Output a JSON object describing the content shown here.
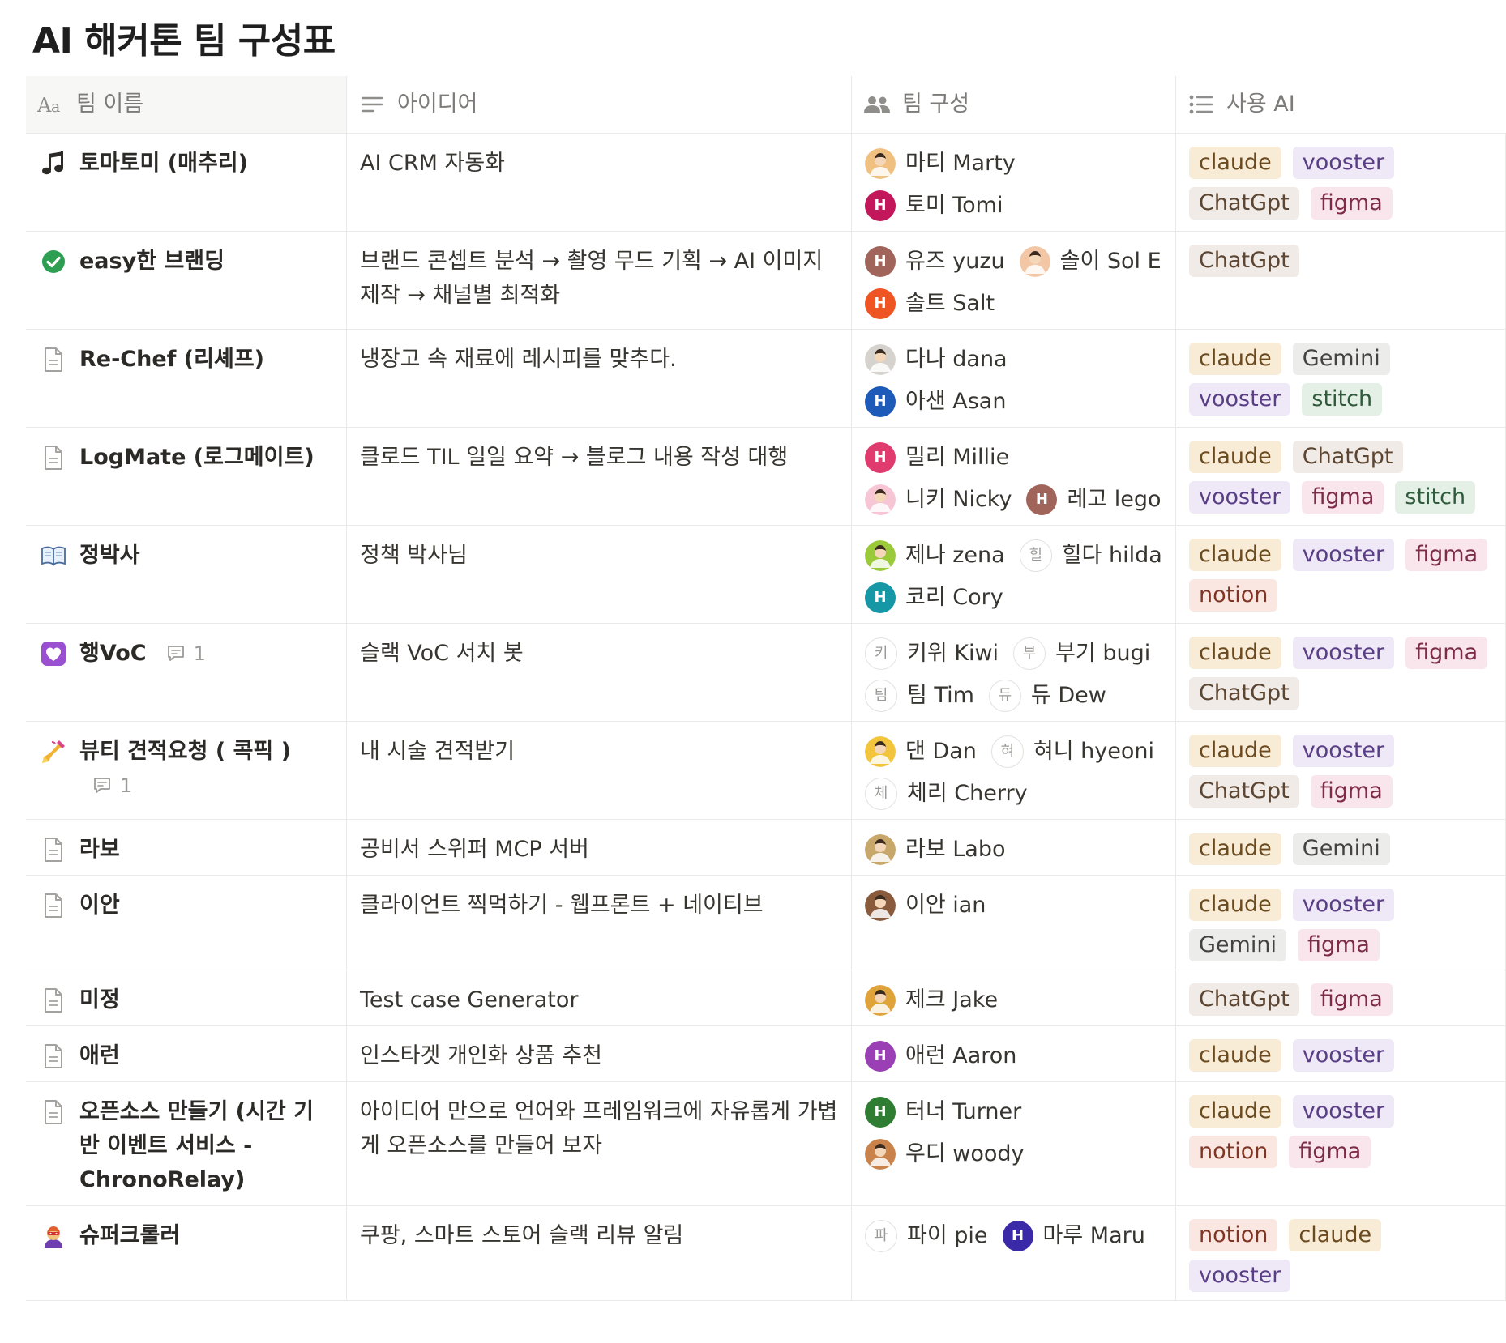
{
  "title": "AI 해커톤 팀 구성표",
  "columns": [
    {
      "label": "팀 이름",
      "icon": "title-property-icon"
    },
    {
      "label": "아이디어",
      "icon": "text-property-icon"
    },
    {
      "label": "팀 구성",
      "icon": "people-property-icon"
    },
    {
      "label": "사용 AI",
      "icon": "multi-select-property-icon"
    }
  ],
  "tag_colors": {
    "claude": {
      "bg": "#f8ecd7",
      "fg": "#6b4a1f"
    },
    "vooster": {
      "bg": "#eee8f7",
      "fg": "#5a3e85"
    },
    "ChatGpt": {
      "bg": "#f0ebe7",
      "fg": "#5c4632"
    },
    "figma": {
      "bg": "#f9e6ec",
      "fg": "#7d2c47"
    },
    "Gemini": {
      "bg": "#ececea",
      "fg": "#444340"
    },
    "stitch": {
      "bg": "#e4efe6",
      "fg": "#2f5a3b"
    },
    "notion": {
      "bg": "#fbe7e1",
      "fg": "#7e3524"
    }
  },
  "rows": [
    {
      "name": "토마토미 (매추리)",
      "icon": "music-note-icon",
      "idea": "AI CRM 자동화",
      "members": [
        {
          "name": "마티 Marty",
          "avatar": "photo",
          "color": "#f0c080"
        },
        {
          "name": "토미 Tomi",
          "avatar": "H",
          "color": "#c2185b"
        }
      ],
      "tags": [
        "claude",
        "vooster",
        "ChatGpt",
        "figma"
      ]
    },
    {
      "name": "easy한 브랜딩",
      "icon": "green-check-icon",
      "idea": "브랜드 콘셉트 분석 → 촬영 무드 기획 → AI 이미지 제작 → 채널별 최적화",
      "members": [
        {
          "name": "유즈 yuzu",
          "avatar": "H",
          "color": "#a0645a"
        },
        {
          "name": "솔이 Sol E",
          "avatar": "photo",
          "color": "#f3c7a6"
        },
        {
          "name": "솔트 Salt",
          "avatar": "H",
          "color": "#ee5522"
        }
      ],
      "tags": [
        "ChatGpt"
      ]
    },
    {
      "name": "Re-Chef (리셰프)",
      "icon": "page-icon",
      "idea": "냉장고 속 재료에 레시피를 맞추다.",
      "members": [
        {
          "name": "다나 dana",
          "avatar": "photo",
          "color": "#d6d3cf"
        },
        {
          "name": "아샌 Asan",
          "avatar": "H",
          "color": "#1e5bb8"
        }
      ],
      "tags": [
        "claude",
        "Gemini",
        "vooster",
        "stitch"
      ]
    },
    {
      "name": "LogMate (로그메이트)",
      "icon": "page-icon",
      "idea": "클로드 TIL 일일 요약 → 블로그 내용 작성 대행",
      "members": [
        {
          "name": "밀리 Millie",
          "avatar": "H",
          "color": "#e03a6e"
        },
        {
          "name": "니키 Nicky",
          "avatar": "photo",
          "color": "#f6c6d4"
        },
        {
          "name": "레고 lego",
          "avatar": "H",
          "color": "#a0645a"
        }
      ],
      "tags": [
        "claude",
        "ChatGpt",
        "vooster",
        "figma",
        "stitch"
      ]
    },
    {
      "name": "정박사",
      "icon": "open-book-icon",
      "idea": "정책 박사님",
      "members": [
        {
          "name": "제나 zena",
          "avatar": "photo",
          "color": "#9ac93a"
        },
        {
          "name": "힐다 hilda",
          "avatar": "힐",
          "color": ""
        },
        {
          "name": "코리 Cory",
          "avatar": "H",
          "color": "#1597a5"
        }
      ],
      "tags": [
        "claude",
        "vooster",
        "figma",
        "notion"
      ]
    },
    {
      "name": "행VoC",
      "icon": "purple-heart-icon",
      "idea": "슬랙 VoC 서치 봇",
      "comments": "1",
      "members": [
        {
          "name": "키위 Kiwi",
          "avatar": "키",
          "color": ""
        },
        {
          "name": "부기 bugi",
          "avatar": "부",
          "color": ""
        },
        {
          "name": "팀 Tim",
          "avatar": "팀",
          "color": ""
        },
        {
          "name": "듀 Dew",
          "avatar": "듀",
          "color": ""
        }
      ],
      "tags": [
        "claude",
        "vooster",
        "figma",
        "ChatGpt"
      ]
    },
    {
      "name": "뷰티 견적요청 ( 콕픽 )",
      "icon": "nail-polish-icon",
      "idea": "내 시술 견적받기",
      "comments": "1",
      "members": [
        {
          "name": "댄 Dan",
          "avatar": "photo",
          "color": "#f2c53d"
        },
        {
          "name": "혀니 hyeoni",
          "avatar": "혀",
          "color": ""
        },
        {
          "name": "체리 Cherry",
          "avatar": "체",
          "color": ""
        }
      ],
      "tags": [
        "claude",
        "vooster",
        "ChatGpt",
        "figma"
      ]
    },
    {
      "name": "라보",
      "icon": "page-icon",
      "idea": "공비서 스위퍼 MCP 서버",
      "members": [
        {
          "name": "라보 Labo",
          "avatar": "photo",
          "color": "#c8a76a"
        }
      ],
      "tags": [
        "claude",
        "Gemini"
      ]
    },
    {
      "name": "이안",
      "icon": "page-icon",
      "idea": "클라이언트 찍먹하기 - 웹프론트 + 네이티브",
      "members": [
        {
          "name": "이안 ian",
          "avatar": "photo",
          "color": "#8a5a3c"
        }
      ],
      "tags": [
        "claude",
        "vooster",
        "Gemini",
        "figma"
      ]
    },
    {
      "name": "미정",
      "icon": "page-icon",
      "idea": "Test case Generator",
      "members": [
        {
          "name": "제크 Jake",
          "avatar": "photo",
          "color": "#e0a33a"
        }
      ],
      "tags": [
        "ChatGpt",
        "figma"
      ]
    },
    {
      "name": "애런",
      "icon": "page-icon",
      "idea": "인스타겟 개인화 상품 추천",
      "members": [
        {
          "name": "애런 Aaron",
          "avatar": "H",
          "color": "#9b3fb5"
        }
      ],
      "tags": [
        "claude",
        "vooster"
      ]
    },
    {
      "name": "오픈소스 만들기 (시간 기반 이벤트 서비스 - ChronoRelay)",
      "icon": "page-icon",
      "idea": "아이디어 만으로 언어와 프레임워크에 자유롭게 가볍게 오픈소스를 만들어 보자",
      "members": [
        {
          "name": "터너 Turner",
          "avatar": "H",
          "color": "#2e7d32"
        },
        {
          "name": "우디 woody",
          "avatar": "photo",
          "color": "#c9834a"
        }
      ],
      "tags": [
        "claude",
        "vooster",
        "notion",
        "figma"
      ]
    },
    {
      "name": "슈퍼크롤러",
      "icon": "superhero-icon",
      "idea": "쿠팡, 스마트 스토어 슬랙 리뷰 알림",
      "members": [
        {
          "name": "파이 pie",
          "avatar": "파",
          "color": ""
        },
        {
          "name": "마루 Maru",
          "avatar": "H",
          "color": "#3b2aa8"
        }
      ],
      "tags": [
        "notion",
        "claude",
        "vooster"
      ]
    }
  ]
}
